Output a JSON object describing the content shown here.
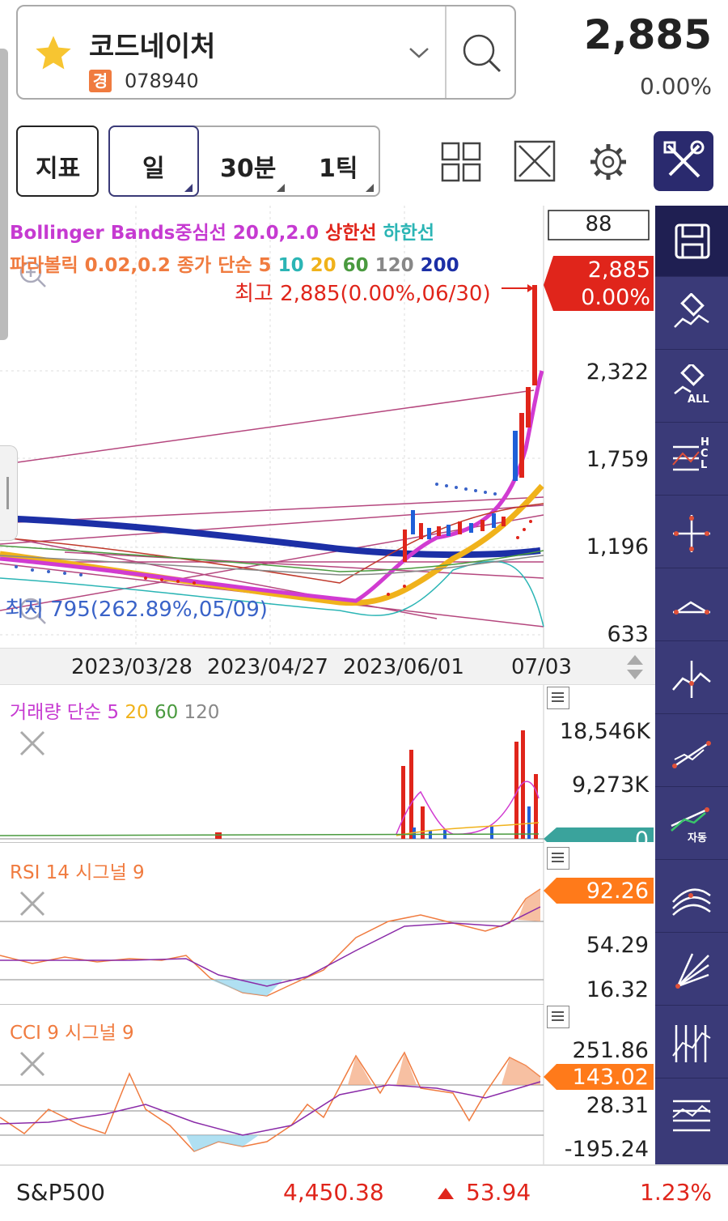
{
  "header": {
    "stock_name": "코드네이처",
    "market_badge": "경",
    "stock_code": "078940",
    "price": "2,885",
    "change_pct": "0.00%",
    "favorite_icon": "star-icon",
    "dropdown_icon": "chevron-down-icon",
    "search_icon": "search-icon"
  },
  "toolbar": {
    "indicator_label": "지표",
    "period_day": "일",
    "period_30min": "30분",
    "period_tick": "1틱",
    "layout_icon": "grid-icon",
    "fullscreen_icon": "expand-icon",
    "settings_icon": "gear-icon",
    "tools_icon": "tools-icon"
  },
  "main_chart": {
    "legend_line1": {
      "prefix": "Bollinger Bands중심선 20.0,2.0 ",
      "upper": "상한선",
      "lower": " 하한선"
    },
    "legend_line2": {
      "prefix": "파라볼릭 0.02,0.2 종가 단순 5 ",
      "ma10": "10",
      "ma20": " 20",
      "ma60": " 60",
      "ma120": " 120",
      "ma200": " 200"
    },
    "visible_count": "88",
    "current_price": "2,885",
    "current_change": "0.00%",
    "high_annotation": "최고 2,885(0.00%,06/30)",
    "low_annotation": "최저 795(262.89%,05/09)",
    "y_labels": [
      "2,322",
      "1,759",
      "1,196",
      "633"
    ],
    "x_labels": [
      "2023/03/28",
      "2023/04/27",
      "2023/06/01",
      "07/03"
    ]
  },
  "volume_pane": {
    "legend_prefix": "거래량 단순 5",
    "legend_20": " 20",
    "legend_60": " 60",
    "legend_120": " 120",
    "y_labels": [
      "18,546K",
      "9,273K"
    ],
    "current": "0"
  },
  "rsi_pane": {
    "legend": "RSI 14 시그널 9",
    "current": "92.26",
    "y_labels": [
      "54.29",
      "16.32"
    ]
  },
  "cci_pane": {
    "legend": "CCI 9 시그널 9",
    "current": "143.02",
    "y_labels": [
      "251.86",
      "28.31",
      "-195.24"
    ]
  },
  "sidebar": {
    "items": [
      "save-icon",
      "eraser-icon",
      "eraser-all-icon",
      "hcl-line-icon",
      "crosshair-icon",
      "trendline-icon",
      "cross-point-icon",
      "diagonal-line-icon",
      "auto-trendline-icon",
      "fan-icon",
      "speed-line-icon",
      "vertical-lines-icon",
      "horizontal-lines-icon"
    ],
    "eraser_all_label": "ALL",
    "hcl_h": "H",
    "hcl_c": "C",
    "hcl_l": "L",
    "auto_label": "자동"
  },
  "footer": {
    "index_name": "S&P500",
    "index_value": "4,450.38",
    "index_change": "53.94",
    "index_change_pct": "1.23%"
  },
  "colors": {
    "up": "#e0251b",
    "down": "#1f5fd8",
    "accent": "#3a3a78",
    "orange_tag": "#ff7a1a",
    "teal_tag": "#3aa39c",
    "bb_mid": "#d13bd1",
    "ma200": "#1c2fa6",
    "ma20": "#f0b21b"
  }
}
